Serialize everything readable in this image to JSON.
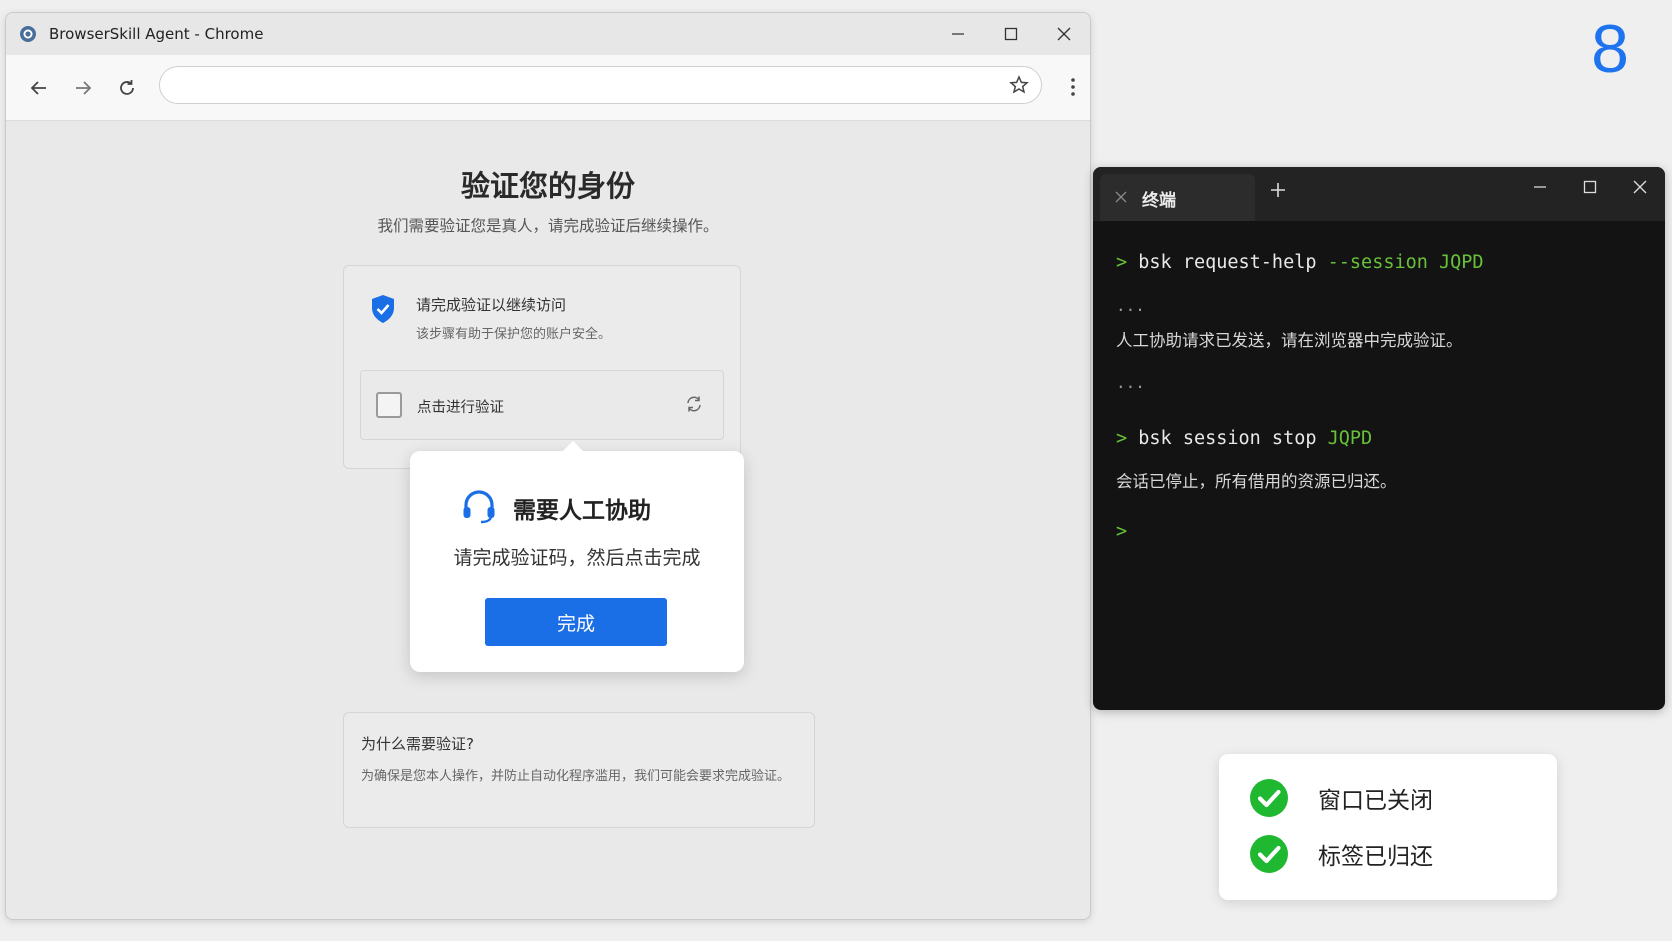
{
  "browser": {
    "window_title": "BrowserSkill Agent - Chrome",
    "address": ""
  },
  "page": {
    "title": "验证您的身份",
    "subtitle": "我们需要验证您是真人，请完成验证后继续操作。",
    "verify_card": {
      "heading": "请完成验证以继续访问",
      "description": "该步骤有助于保护您的账户安全。",
      "checkbox_label": "点击进行验证"
    },
    "help_popup": {
      "title": "需要人工协助",
      "message": "请完成验证码，然后点击完成",
      "done_button": "完成"
    },
    "why_card": {
      "title": "为什么需要验证?",
      "text": "为确保是您本人操作，并防止自动化程序滥用，我们可能会要求完成验证。"
    }
  },
  "step_number": "8",
  "terminal": {
    "tab_label": "终端",
    "lines": {
      "prompt1": ">",
      "cmd1_base": "bsk request-help",
      "cmd1_flag": "--session JQPD",
      "dots1": "...",
      "out1": "人工协助请求已发送，请在浏览器中完成验证。",
      "dots2": "...",
      "prompt2": ">",
      "cmd2_base": "bsk session stop",
      "cmd2_arg": "JQPD",
      "out2": "会话已停止，所有借用的资源已归还。",
      "prompt3": ">"
    }
  },
  "status": {
    "items": [
      "窗口已关闭",
      "标签已归还"
    ],
    "check_color": "#1fb830"
  },
  "colors": {
    "accent_blue": "#1b6fe6",
    "terminal_green": "#67c23a",
    "step_blue": "#1e74ee"
  }
}
